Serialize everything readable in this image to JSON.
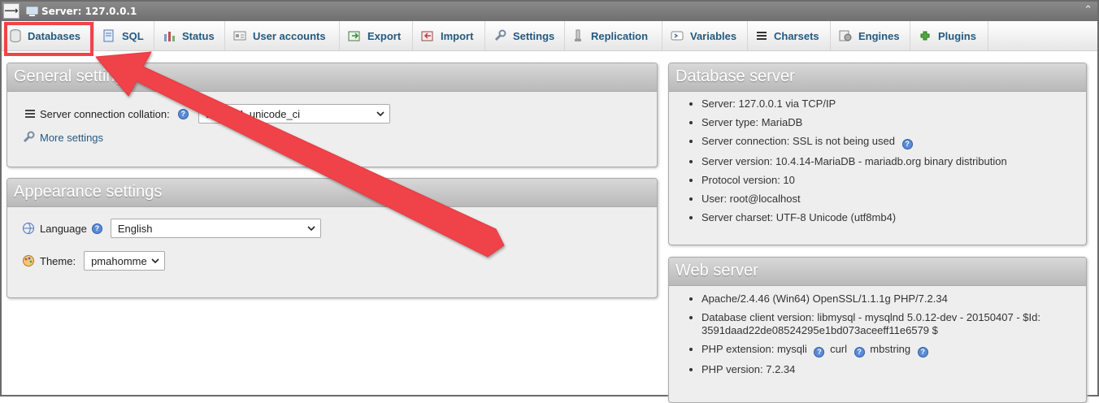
{
  "topbar": {
    "toggle_glyph": "⟶",
    "title": "Server: 127.0.0.1",
    "collapse_glyph": "⌃"
  },
  "tabs": [
    {
      "label": "Databases",
      "icon": "database-icon"
    },
    {
      "label": "SQL",
      "icon": "sql-icon"
    },
    {
      "label": "Status",
      "icon": "status-icon"
    },
    {
      "label": "User accounts",
      "icon": "user-accounts-icon"
    },
    {
      "label": "Export",
      "icon": "export-icon"
    },
    {
      "label": "Import",
      "icon": "import-icon"
    },
    {
      "label": "Settings",
      "icon": "wrench-icon"
    },
    {
      "label": "Replication",
      "icon": "replication-icon"
    },
    {
      "label": "Variables",
      "icon": "variables-icon"
    },
    {
      "label": "Charsets",
      "icon": "charsets-icon"
    },
    {
      "label": "Engines",
      "icon": "engines-icon"
    },
    {
      "label": "Plugins",
      "icon": "plugins-icon"
    }
  ],
  "general_settings": {
    "title": "General settings",
    "collation_label": "Server connection collation:",
    "collation_value": "utf8mb4_unicode_ci",
    "more_settings": "More settings"
  },
  "appearance_settings": {
    "title": "Appearance settings",
    "language_label": "Language",
    "language_value": "English",
    "theme_label": "Theme:",
    "theme_value": "pmahomme"
  },
  "database_server": {
    "title": "Database server",
    "items": [
      "Server: 127.0.0.1 via TCP/IP",
      "Server type: MariaDB",
      "Server connection: SSL is not being used",
      "Server version: 10.4.14-MariaDB - mariadb.org binary distribution",
      "Protocol version: 10",
      "User: root@localhost",
      "Server charset: UTF-8 Unicode (utf8mb4)"
    ]
  },
  "web_server": {
    "title": "Web server",
    "items": [
      "Apache/2.4.46 (Win64) OpenSSL/1.1.1g PHP/7.2.34",
      "Database client version: libmysql - mysqlnd 5.0.12-dev - 20150407 - $Id: 3591daad22de08524295e1bd073aceeff11e6579 $",
      "PHP extension: mysqli",
      "curl",
      "mbstring",
      "PHP version: 7.2.34"
    ]
  },
  "help_glyph": "?",
  "colors": {
    "highlight": "#f0434a",
    "link": "#235a81"
  }
}
